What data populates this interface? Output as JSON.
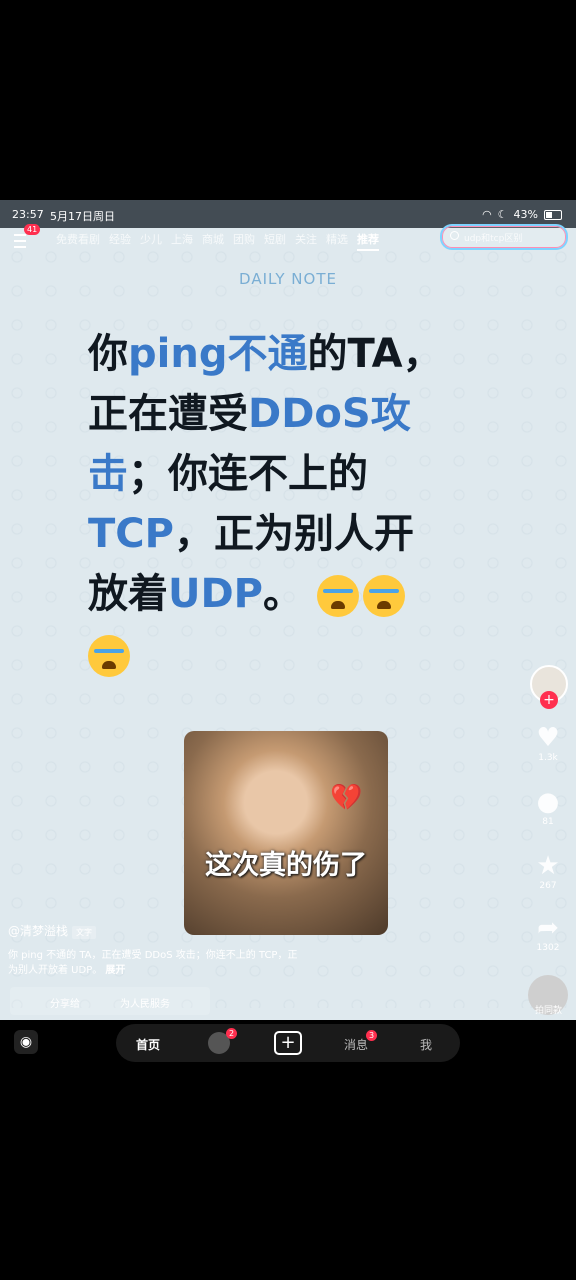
{
  "status": {
    "time": "23:57",
    "date": "5月17日周日",
    "battery": "43%"
  },
  "nav": {
    "badge": "41",
    "tabs": [
      "免费看剧",
      "经验",
      "少儿",
      "上海",
      "商城",
      "团购",
      "短剧",
      "关注",
      "精选",
      "推荐"
    ],
    "active_tab": "推荐",
    "search_placeholder": "udp和tcp区别"
  },
  "post": {
    "daily": "DAILY NOTE",
    "line1_a": "你",
    "line1_b": "ping不通",
    "line1_c": "的TA，",
    "line2_a": "正在遭受",
    "line2_b": "DDoS攻",
    "line3_a": "击",
    "line3_b": "；你连不上的",
    "line4_a": "TCP",
    "line4_b": "，正为别人开",
    "line5_a": "放着",
    "line5_b": "UDP",
    "line5_c": "。",
    "meme_caption": "这次真的伤了",
    "author": "@清梦溢栈",
    "tag": "文字",
    "description": "你 ping 不通的 TA，正在遭受 DDoS 攻击；你连不上的 TCP，正为别人开放着 UDP。",
    "expand": "展开",
    "share_label": "分享给",
    "share_target": "为人民服务"
  },
  "rail": {
    "like": "1.3k",
    "comment": "81",
    "favorite": "267",
    "share": "1302",
    "music": "拍同款"
  },
  "bottom": {
    "home": "首页",
    "friend_badge": "2",
    "messages": "消息",
    "messages_badge": "3",
    "me": "我"
  },
  "colors": {
    "accent": "#3a79c8",
    "badge": "#ff2f4f"
  }
}
